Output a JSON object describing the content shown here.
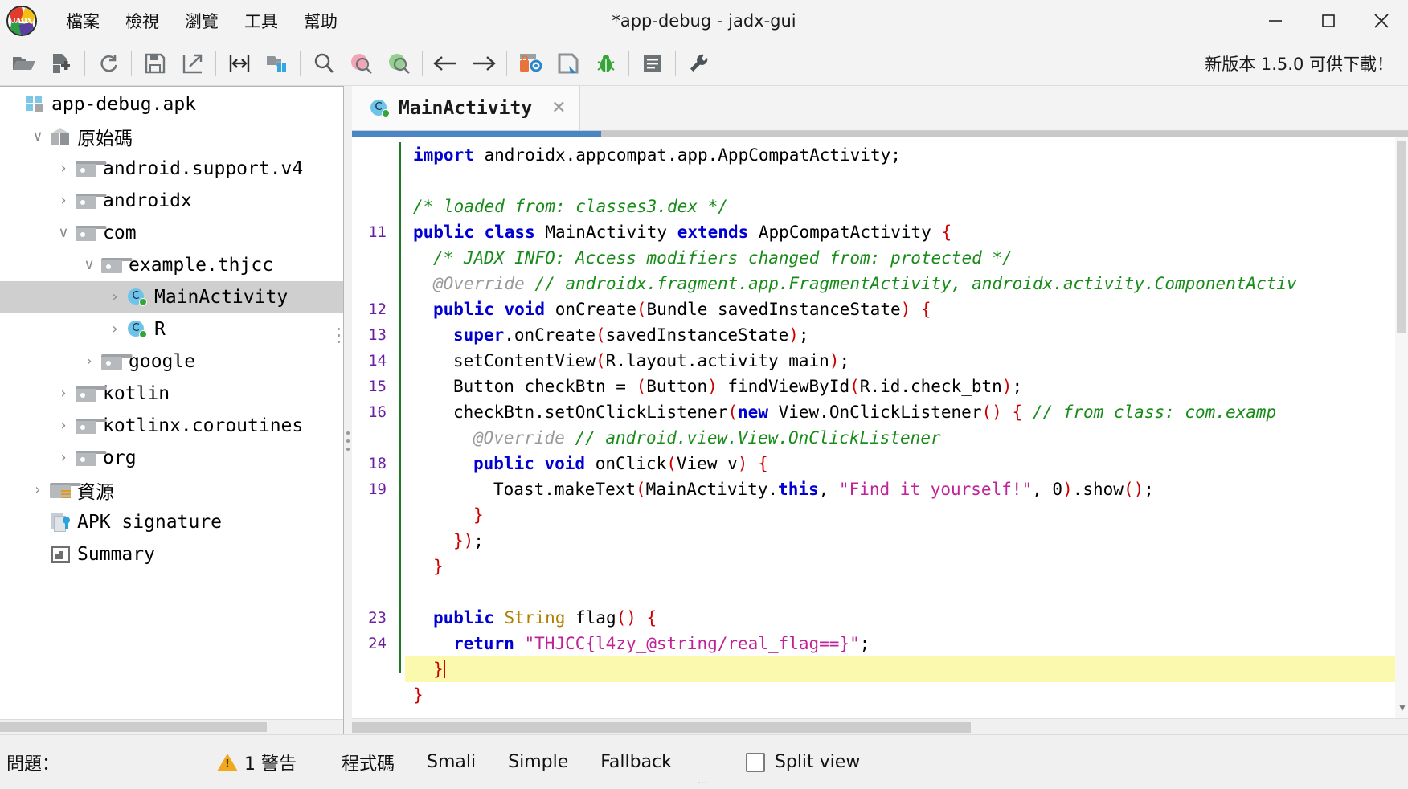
{
  "window": {
    "title": "*app-debug - jadx-gui",
    "app_logo_text": "JADX",
    "minimize": "—",
    "maximize": "☐",
    "close": "✕"
  },
  "menubar": {
    "items": [
      {
        "label": "檔案",
        "name": "menu-file"
      },
      {
        "label": "檢視",
        "name": "menu-view"
      },
      {
        "label": "瀏覽",
        "name": "menu-navigation"
      },
      {
        "label": "工具",
        "name": "menu-tools"
      },
      {
        "label": "幫助",
        "name": "menu-help"
      }
    ]
  },
  "toolbar": {
    "buttons": [
      {
        "name": "open-file-icon",
        "tip": "Open file"
      },
      {
        "name": "add-files-icon",
        "tip": "Add files"
      },
      {
        "name": "reload-icon",
        "tip": "Reload"
      },
      {
        "name": "save-all-icon",
        "tip": "Save all"
      },
      {
        "name": "export-gradle-icon",
        "tip": "Export"
      },
      {
        "name": "sync-icon",
        "tip": "Sync"
      },
      {
        "name": "flat-packages-icon",
        "tip": "Flat packages"
      },
      {
        "name": "search-icon",
        "tip": "Search text"
      },
      {
        "name": "search-class-icon",
        "tip": "Search class"
      },
      {
        "name": "search-comment-icon",
        "tip": "Search comment"
      },
      {
        "name": "back-arrow-icon",
        "tip": "Back"
      },
      {
        "name": "forward-arrow-icon",
        "tip": "Forward"
      },
      {
        "name": "deobfuscation-icon",
        "tip": "Deobfuscation"
      },
      {
        "name": "quark-icon",
        "tip": "Quark engine"
      },
      {
        "name": "debug-bug-icon",
        "tip": "Debugger"
      },
      {
        "name": "log-viewer-icon",
        "tip": "Log viewer"
      },
      {
        "name": "preferences-wrench-icon",
        "tip": "Preferences"
      }
    ],
    "new_version": "新版本 1.5.0 可供下載！"
  },
  "tree": {
    "nodes": [
      {
        "label": "app-debug.apk",
        "icon": "apk-icon",
        "indent": 0,
        "twist": "",
        "selected": false,
        "cjk": false
      },
      {
        "label": "原始碼",
        "icon": "box-icon",
        "indent": 1,
        "twist": "expanded",
        "selected": false,
        "cjk": true
      },
      {
        "label": "android.support.v4",
        "icon": "folder-icon",
        "indent": 2,
        "twist": "collapsed",
        "selected": false,
        "cjk": false
      },
      {
        "label": "androidx",
        "icon": "folder-icon",
        "indent": 2,
        "twist": "collapsed",
        "selected": false,
        "cjk": false
      },
      {
        "label": "com",
        "icon": "folder-icon",
        "indent": 2,
        "twist": "expanded",
        "selected": false,
        "cjk": false
      },
      {
        "label": "example.thjcc",
        "icon": "folder-icon",
        "indent": 3,
        "twist": "expanded",
        "selected": false,
        "cjk": false
      },
      {
        "label": "MainActivity",
        "icon": "class-icon",
        "indent": 4,
        "twist": "collapsed",
        "selected": true,
        "cjk": false
      },
      {
        "label": "R",
        "icon": "class-icon",
        "indent": 4,
        "twist": "collapsed",
        "selected": false,
        "cjk": false
      },
      {
        "label": "google",
        "icon": "folder-icon",
        "indent": 3,
        "twist": "collapsed",
        "selected": false,
        "cjk": false
      },
      {
        "label": "kotlin",
        "icon": "folder-icon",
        "indent": 2,
        "twist": "collapsed",
        "selected": false,
        "cjk": false
      },
      {
        "label": "kotlinx.coroutines",
        "icon": "folder-icon",
        "indent": 2,
        "twist": "collapsed",
        "selected": false,
        "cjk": false
      },
      {
        "label": "org",
        "icon": "folder-icon",
        "indent": 2,
        "twist": "collapsed",
        "selected": false,
        "cjk": false
      },
      {
        "label": "資源",
        "icon": "resources-folder-icon",
        "indent": 1,
        "twist": "collapsed",
        "selected": false,
        "cjk": true
      },
      {
        "label": "APK signature",
        "icon": "apk-signature-icon",
        "indent": 1,
        "twist": "",
        "selected": false,
        "cjk": false
      },
      {
        "label": "Summary",
        "icon": "summary-icon",
        "indent": 1,
        "twist": "",
        "selected": false,
        "cjk": false
      }
    ]
  },
  "editor": {
    "tab": {
      "title": "MainActivity",
      "icon": "class-icon",
      "close": "✕"
    },
    "lines": [
      {
        "num": "",
        "tokens": [
          {
            "t": "kw",
            "v": "import"
          },
          {
            "t": "",
            "v": " androidx.appcompat.app.AppCompatActivity;"
          }
        ],
        "indent": 0,
        "hl": false
      },
      {
        "num": "",
        "tokens": [],
        "indent": 0,
        "hl": false
      },
      {
        "num": "",
        "tokens": [
          {
            "t": "cmt",
            "v": "/* loaded from: classes3.dex */"
          }
        ],
        "indent": 0,
        "hl": false
      },
      {
        "num": "11",
        "tokens": [
          {
            "t": "kw",
            "v": "public class"
          },
          {
            "t": "",
            "v": " MainActivity "
          },
          {
            "t": "kw",
            "v": "extends"
          },
          {
            "t": "",
            "v": " AppCompatActivity "
          },
          {
            "t": "pn",
            "v": "{"
          }
        ],
        "indent": 0,
        "hl": false
      },
      {
        "num": "",
        "tokens": [
          {
            "t": "cmt",
            "v": "/* JADX INFO: Access modifiers changed from: protected */"
          }
        ],
        "indent": 1,
        "hl": false
      },
      {
        "num": "",
        "tokens": [
          {
            "t": "anno",
            "v": "@Override"
          },
          {
            "t": "",
            "v": " "
          },
          {
            "t": "cmt",
            "v": "// androidx.fragment.app.FragmentActivity, androidx.activity.ComponentActiv"
          }
        ],
        "indent": 1,
        "hl": false
      },
      {
        "num": "12",
        "tokens": [
          {
            "t": "kw",
            "v": "public void"
          },
          {
            "t": "",
            "v": " onCreate"
          },
          {
            "t": "pn",
            "v": "("
          },
          {
            "t": "",
            "v": "Bundle savedInstanceState"
          },
          {
            "t": "pn",
            "v": ")"
          },
          {
            "t": "",
            "v": " "
          },
          {
            "t": "pn",
            "v": "{"
          }
        ],
        "indent": 1,
        "hl": false
      },
      {
        "num": "13",
        "tokens": [
          {
            "t": "kw",
            "v": "super"
          },
          {
            "t": "",
            "v": ".onCreate"
          },
          {
            "t": "pn",
            "v": "("
          },
          {
            "t": "",
            "v": "savedInstanceState"
          },
          {
            "t": "pn",
            "v": ")"
          },
          {
            "t": "",
            "v": ";"
          }
        ],
        "indent": 2,
        "hl": false
      },
      {
        "num": "14",
        "tokens": [
          {
            "t": "",
            "v": "setContentView"
          },
          {
            "t": "pn",
            "v": "("
          },
          {
            "t": "",
            "v": "R.layout.activity_main"
          },
          {
            "t": "pn",
            "v": ")"
          },
          {
            "t": "",
            "v": ";"
          }
        ],
        "indent": 2,
        "hl": false
      },
      {
        "num": "15",
        "tokens": [
          {
            "t": "",
            "v": "Button checkBtn = "
          },
          {
            "t": "pn",
            "v": "("
          },
          {
            "t": "",
            "v": "Button"
          },
          {
            "t": "pn",
            "v": ")"
          },
          {
            "t": "",
            "v": " findViewById"
          },
          {
            "t": "pn",
            "v": "("
          },
          {
            "t": "",
            "v": "R.id.check_btn"
          },
          {
            "t": "pn",
            "v": ")"
          },
          {
            "t": "",
            "v": ";"
          }
        ],
        "indent": 2,
        "hl": false
      },
      {
        "num": "16",
        "tokens": [
          {
            "t": "",
            "v": "checkBtn.setOnClickListener"
          },
          {
            "t": "pn",
            "v": "("
          },
          {
            "t": "kw",
            "v": "new"
          },
          {
            "t": "",
            "v": " View.OnClickListener"
          },
          {
            "t": "pn",
            "v": "()"
          },
          {
            "t": "",
            "v": " "
          },
          {
            "t": "pn",
            "v": "{"
          },
          {
            "t": "",
            "v": " "
          },
          {
            "t": "cmt",
            "v": "// from class: com.examp"
          }
        ],
        "indent": 2,
        "hl": false
      },
      {
        "num": "",
        "tokens": [
          {
            "t": "anno",
            "v": "@Override"
          },
          {
            "t": "",
            "v": " "
          },
          {
            "t": "cmt",
            "v": "// android.view.View.OnClickListener"
          }
        ],
        "indent": 3,
        "hl": false
      },
      {
        "num": "18",
        "tokens": [
          {
            "t": "kw",
            "v": "public void"
          },
          {
            "t": "",
            "v": " onClick"
          },
          {
            "t": "pn",
            "v": "("
          },
          {
            "t": "",
            "v": "View v"
          },
          {
            "t": "pn",
            "v": ")"
          },
          {
            "t": "",
            "v": " "
          },
          {
            "t": "pn",
            "v": "{"
          }
        ],
        "indent": 3,
        "hl": false
      },
      {
        "num": "19",
        "tokens": [
          {
            "t": "",
            "v": "Toast.makeText"
          },
          {
            "t": "pn",
            "v": "("
          },
          {
            "t": "",
            "v": "MainActivity."
          },
          {
            "t": "kw",
            "v": "this"
          },
          {
            "t": "",
            "v": ", "
          },
          {
            "t": "str",
            "v": "\"Find it yourself!\""
          },
          {
            "t": "",
            "v": ", 0"
          },
          {
            "t": "pn",
            "v": ")"
          },
          {
            "t": "",
            "v": ".show"
          },
          {
            "t": "pn",
            "v": "()"
          },
          {
            "t": "",
            "v": ";"
          }
        ],
        "indent": 4,
        "hl": false
      },
      {
        "num": "",
        "tokens": [
          {
            "t": "pn",
            "v": "}"
          }
        ],
        "indent": 3,
        "hl": false
      },
      {
        "num": "",
        "tokens": [
          {
            "t": "pn",
            "v": "})"
          },
          {
            "t": "",
            "v": ";"
          }
        ],
        "indent": 2,
        "hl": false
      },
      {
        "num": "",
        "tokens": [
          {
            "t": "pn",
            "v": "}"
          }
        ],
        "indent": 1,
        "hl": false
      },
      {
        "num": "",
        "tokens": [],
        "indent": 0,
        "hl": false
      },
      {
        "num": "23",
        "tokens": [
          {
            "t": "kw",
            "v": "public"
          },
          {
            "t": "",
            "v": " "
          },
          {
            "t": "typ",
            "v": "String"
          },
          {
            "t": "",
            "v": " flag"
          },
          {
            "t": "pn",
            "v": "()"
          },
          {
            "t": "",
            "v": " "
          },
          {
            "t": "pn",
            "v": "{"
          }
        ],
        "indent": 1,
        "hl": false
      },
      {
        "num": "24",
        "tokens": [
          {
            "t": "kw",
            "v": "return"
          },
          {
            "t": "",
            "v": " "
          },
          {
            "t": "str",
            "v": "\"THJCC{l4zy_@string/real_flag==}\""
          },
          {
            "t": "",
            "v": ";"
          }
        ],
        "indent": 2,
        "hl": false
      },
      {
        "num": "",
        "tokens": [
          {
            "t": "pn",
            "v": "}"
          },
          {
            "t": "caret",
            "v": ""
          }
        ],
        "indent": 1,
        "hl": true
      },
      {
        "num": "",
        "tokens": [
          {
            "t": "pn",
            "v": "}"
          }
        ],
        "indent": 0,
        "hl": false
      }
    ]
  },
  "status": {
    "problems_label": "問題：",
    "warning_count": "1 警告",
    "view_tabs": [
      {
        "label": "程式碼",
        "name": "tab-code"
      },
      {
        "label": "Smali",
        "name": "tab-smali"
      },
      {
        "label": "Simple",
        "name": "tab-simple"
      },
      {
        "label": "Fallback",
        "name": "tab-fallback"
      }
    ],
    "split_view_label": "Split view",
    "split_view_checked": false
  },
  "colors": {
    "accent": "#4a86c5",
    "keyword": "#0000d0",
    "comment": "#188c18",
    "string": "#c0229a",
    "type": "#b08000",
    "paren": "#cc0000",
    "linenum": "#6a1fa0",
    "highlight": "#fbf9ae",
    "warning": "#f0a81e"
  }
}
